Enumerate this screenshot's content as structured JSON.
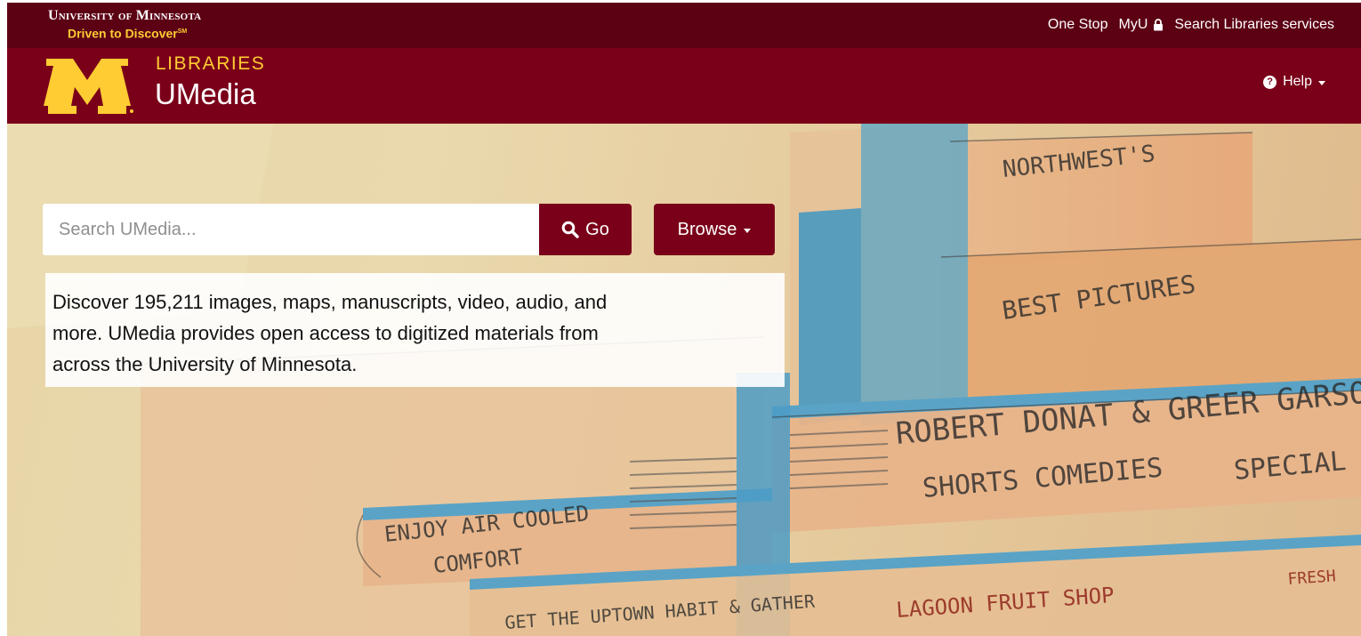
{
  "utility_bar": {
    "university_name": "University of Minnesota",
    "tagline": "Driven to Discover",
    "tagline_mark": "SM",
    "links": [
      {
        "label": "One Stop"
      },
      {
        "label": "MyU",
        "icon": "lock-icon"
      },
      {
        "label": "Search Libraries services"
      }
    ]
  },
  "header": {
    "logo": "block-m-logo",
    "subtitle": "LIBRARIES",
    "title": "UMedia",
    "help_label": "Help",
    "help_icon": "question-circle-icon"
  },
  "search": {
    "placeholder": "Search UMedia...",
    "go_label": "Go",
    "browse_label": "Browse"
  },
  "intro": {
    "line1": "Discover 195,211 images, maps, manuscripts, video, audio, and",
    "line2": "more. UMedia provides open access to digitized materials from",
    "line3": "across the University of Minnesota."
  },
  "hero_art": {
    "signs": [
      "NORTHWEST'S",
      "BEST PICTURES",
      "ROBERT DONAT & GREER GARSON",
      "SHORTS   COMEDIES",
      "SPECIAL",
      "ENJOY AIR COOLED",
      "COMFORT",
      "GET THE UPTOWN HABIT & GATHER",
      "LAGOON FRUIT SHOP",
      "FRESH"
    ]
  },
  "colors": {
    "maroon": "#7a0019",
    "dark_maroon": "#5c0014",
    "gold": "#ffcc33"
  }
}
